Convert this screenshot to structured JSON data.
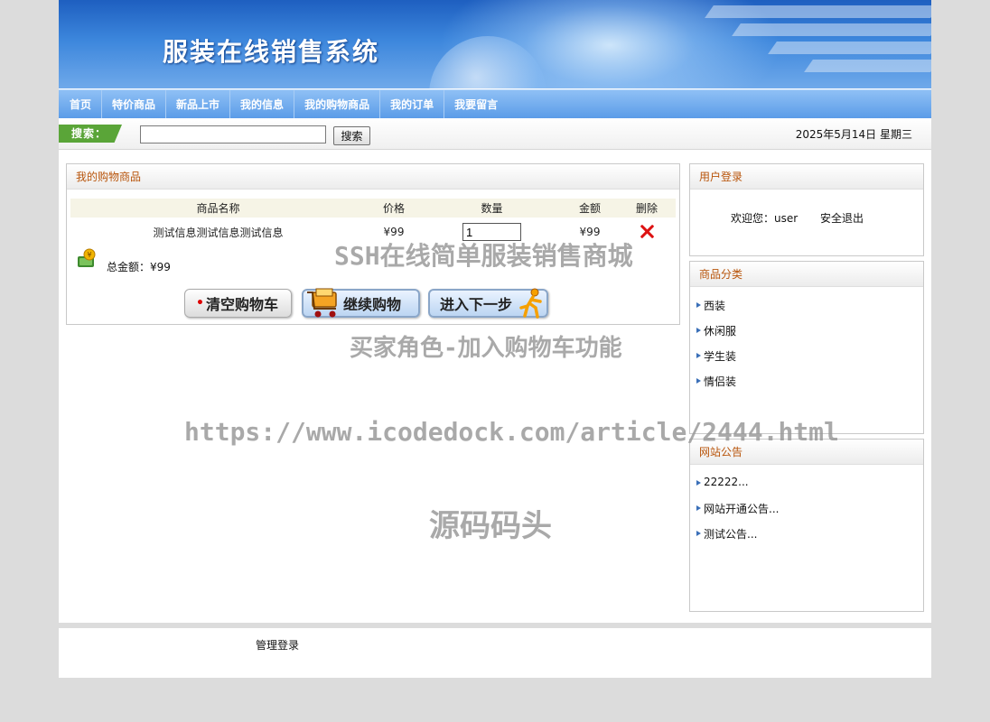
{
  "banner": {
    "title": "服装在线销售系统"
  },
  "nav": {
    "items": [
      {
        "label": "首页"
      },
      {
        "label": "特价商品"
      },
      {
        "label": "新品上市"
      },
      {
        "label": "我的信息"
      },
      {
        "label": "我的购物商品"
      },
      {
        "label": "我的订单"
      },
      {
        "label": "我要留言"
      }
    ]
  },
  "search": {
    "label": "搜索：",
    "value": "",
    "button": "搜索",
    "date": "2025年5月14日 星期三"
  },
  "cart": {
    "title": "我的购物商品",
    "columns": [
      "商品名称",
      "价格",
      "数量",
      "金额",
      "删除"
    ],
    "rows": [
      {
        "name": "测试信息测试信息测试信息",
        "price": "¥99",
        "quantity": "1",
        "amount": "¥99"
      }
    ],
    "total": "总金额：¥99",
    "buttons": {
      "clear": "清空购物车",
      "continue": "继续购物",
      "next": "进入下一步"
    }
  },
  "login": {
    "title": "用户登录",
    "welcome": "欢迎您：user",
    "logout": "安全退出"
  },
  "categories": {
    "title": "商品分类",
    "items": [
      "西装",
      "休闲服",
      "学生装",
      "情侣装"
    ]
  },
  "notices": {
    "title": "网站公告",
    "items": [
      "22222...",
      "网站开通公告...",
      "测试公告..."
    ]
  },
  "footer": {
    "admin_login": "管理登录"
  },
  "watermarks": {
    "line1": "SSH在线简单服装销售商城",
    "line2": "买家角色-加入购物车功能",
    "line3": "https://www.icodedock.com/article/2444.html",
    "line4": "源码码头"
  },
  "colors": {
    "nav_bg": "#5b9ce8",
    "panel_title": "#b8540a",
    "search_tag": "#5aa538",
    "delete_icon": "#dd1111"
  },
  "icons": {
    "delete": "delete-x-icon",
    "money": "money-icon",
    "cart": "shopping-cart-icon",
    "runner": "runner-icon"
  }
}
